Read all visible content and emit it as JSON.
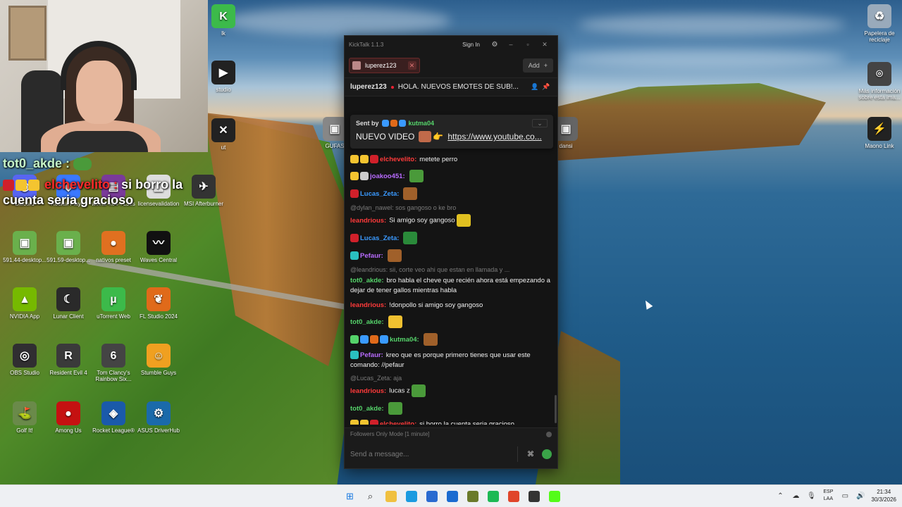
{
  "overlay": {
    "user1": "tot0_akde :",
    "user2": "elchevelito :",
    "message2": "si borro la cuenta seria gracioso"
  },
  "desktop_icons": [
    {
      "label": "Discord",
      "color": "#5865f2",
      "glyph": "◉"
    },
    {
      "label": "Roblox Player",
      "color": "#3a78ff",
      "glyph": "◆"
    },
    {
      "label": "winrar-x64-713es",
      "color": "#7a3a9a",
      "glyph": "▤"
    },
    {
      "label": "licensevalidation",
      "color": "#dddddd",
      "glyph": "▦"
    },
    {
      "label": "MSI Afterburner",
      "color": "#333333",
      "glyph": "✈"
    },
    {
      "label": "591.44-desktop...",
      "color": "#6ab04c",
      "glyph": "▣"
    },
    {
      "label": "591.59-desktop...",
      "color": "#6ab04c",
      "glyph": "▣"
    },
    {
      "label": "nativos preset",
      "color": "#e07020",
      "glyph": "●"
    },
    {
      "label": "Waves Central",
      "color": "#111111",
      "glyph": "〰"
    },
    {
      "label": "NVIDIA App",
      "color": "#76b900",
      "glyph": "▲"
    },
    {
      "label": "Lunar Client",
      "color": "#2a2a2a",
      "glyph": "☾"
    },
    {
      "label": "uTorrent Web",
      "color": "#3cba4a",
      "glyph": "µ"
    },
    {
      "label": "FL Studio 2024",
      "color": "#e06a1a",
      "glyph": "❦"
    },
    {
      "label": "OBS Studio",
      "color": "#302e31",
      "glyph": "◎"
    },
    {
      "label": "Resident Evil 4",
      "color": "#3a3a3a",
      "glyph": "R"
    },
    {
      "label": "Tom Clancy's Rainbow Six...",
      "color": "#444444",
      "glyph": "6"
    },
    {
      "label": "Stumble Guys",
      "color": "#f0a020",
      "glyph": "☺"
    },
    {
      "label": "Golf It!",
      "color": "#6a8a4a",
      "glyph": "⛳"
    },
    {
      "label": "Among Us",
      "color": "#c51111",
      "glyph": "●"
    },
    {
      "label": "Rocket League®",
      "color": "#1a5aaa",
      "glyph": "◈"
    },
    {
      "label": "ASUS DriverHub",
      "color": "#1a6aaa",
      "glyph": "⚙"
    },
    {
      "label": "Papelera de reciclaje",
      "color": "#9ab",
      "glyph": "♻"
    },
    {
      "label": "Más información sobre esta ima...",
      "color": "#444",
      "glyph": "⌾"
    },
    {
      "label": "Maono Link",
      "color": "#222",
      "glyph": "⚡"
    },
    {
      "label": "lk",
      "color": "#3cba4a",
      "glyph": "K"
    },
    {
      "label": "studio",
      "color": "#222",
      "glyph": "▶"
    },
    {
      "label": "ut",
      "color": "#222",
      "glyph": "✕"
    },
    {
      "label": "GUFAS",
      "color": "#888",
      "glyph": "▣"
    },
    {
      "label": "dansi",
      "color": "#666",
      "glyph": "▣"
    }
  ],
  "kicktalk": {
    "title": "KickTalk 1.1.3",
    "sign_in": "Sign In",
    "window_controls": [
      "–",
      "▫",
      "✕"
    ],
    "tab_label": "luperez123",
    "add_label": "Add",
    "streamer": "luperez123",
    "stream_title": "HOLA. NUEVOS EMOTES DE SUB!...",
    "pinned": {
      "sent_by": "Sent by",
      "user": "kutma04",
      "text": "NUEVO VIDEO",
      "link": "https://www.youtube.co..."
    },
    "messages": [
      {
        "user": "elchevelito:",
        "color": "#ff3a3a",
        "text": "metete perro",
        "badges": [
          "#f4c430",
          "#f4c430",
          "#d0202a"
        ]
      },
      {
        "user": "joakoo451:",
        "color": "#b86bff",
        "text": "",
        "badges": [
          "#f4c430",
          "#ccc"
        ],
        "emote": "#4a9a3a"
      },
      {
        "user": "Lucas_Zeta:",
        "color": "#3a9aff",
        "text": "",
        "badges": [
          "#d0202a"
        ],
        "emote": "#a0602a"
      },
      {
        "reply": "@dylan_nawel: sos gangoso o ke bro"
      },
      {
        "user": "leandrious:",
        "color": "#ff3a3a",
        "text": "Si amigo soy gangoso",
        "badges": [],
        "emote": "#e0c020"
      },
      {
        "user": "Lucas_Zeta:",
        "color": "#3a9aff",
        "text": "",
        "badges": [
          "#d0202a"
        ],
        "emote": "#2a8a3a"
      },
      {
        "user": "Pefaur:",
        "color": "#b86bff",
        "text": "",
        "badges": [
          "#2ac0c0"
        ],
        "emote": "#a0602a"
      },
      {
        "reply": "@leandrious: sii, corte veo ahi que estan en llamada y ..."
      },
      {
        "user": "tot0_akde:",
        "color": "#55d36a",
        "text": "bro habla el cheve que recién ahora está empezando a dejar de tener gallos mientras habla",
        "badges": []
      },
      {
        "user": "leandrious:",
        "color": "#ff3a3a",
        "text": "!donpollo si amigo soy gangoso",
        "badges": []
      },
      {
        "user": "tot0_akde:",
        "color": "#55d36a",
        "text": "",
        "badges": [],
        "emote": "#f0c030"
      },
      {
        "user": "kutma04:",
        "color": "#55d36a",
        "text": "",
        "badges": [
          "#55d36a",
          "#3a9aff",
          "#e06a1a",
          "#3a9aff"
        ],
        "emote": "#a0602a"
      },
      {
        "user": "Pefaur:",
        "color": "#b86bff",
        "text": "kreo que es porque primero tienes que usar este comando: //pefaur",
        "badges": [
          "#2ac0c0"
        ]
      },
      {
        "reply": "@Lucas_Zeta: aja"
      },
      {
        "user": "leandrious:",
        "color": "#ff3a3a",
        "text": "lucas z",
        "badges": [],
        "emote": "#4a9a3a"
      },
      {
        "user": "tot0_akde:",
        "color": "#55d36a",
        "text": "",
        "badges": [],
        "emote": "#4a9a3a"
      },
      {
        "user": "elchevelito:",
        "color": "#ff3a3a",
        "text": "si borro la cuenta seria gracioso",
        "badges": [
          "#f4c430",
          "#f4c430",
          "#d0202a"
        ]
      }
    ],
    "mode_text": "Followers Only Mode [1 minute]",
    "input_placeholder": "Send a message..."
  },
  "taskbar": {
    "apps": [
      {
        "name": "start",
        "color": "#1a7ae0",
        "glyph": "⊞"
      },
      {
        "name": "search",
        "color": "transparent",
        "glyph": "⌕"
      },
      {
        "name": "file-explorer",
        "color": "#f0c040",
        "glyph": ""
      },
      {
        "name": "edge",
        "color": "#1a9ae0",
        "glyph": ""
      },
      {
        "name": "store",
        "color": "#2a6ad0",
        "glyph": ""
      },
      {
        "name": "outlook",
        "color": "#1a6ad0",
        "glyph": ""
      },
      {
        "name": "app-green-box",
        "color": "#6a7a2a",
        "glyph": ""
      },
      {
        "name": "spotify",
        "color": "#1db954",
        "glyph": ""
      },
      {
        "name": "chrome",
        "color": "#e0452a",
        "glyph": ""
      },
      {
        "name": "app-dark",
        "color": "#333333",
        "glyph": ""
      },
      {
        "name": "kick",
        "color": "#53fc18",
        "glyph": ""
      }
    ],
    "lang_top": "ESP",
    "lang_bottom": "LAA",
    "time": "21:34",
    "date": "30/3/2026"
  }
}
